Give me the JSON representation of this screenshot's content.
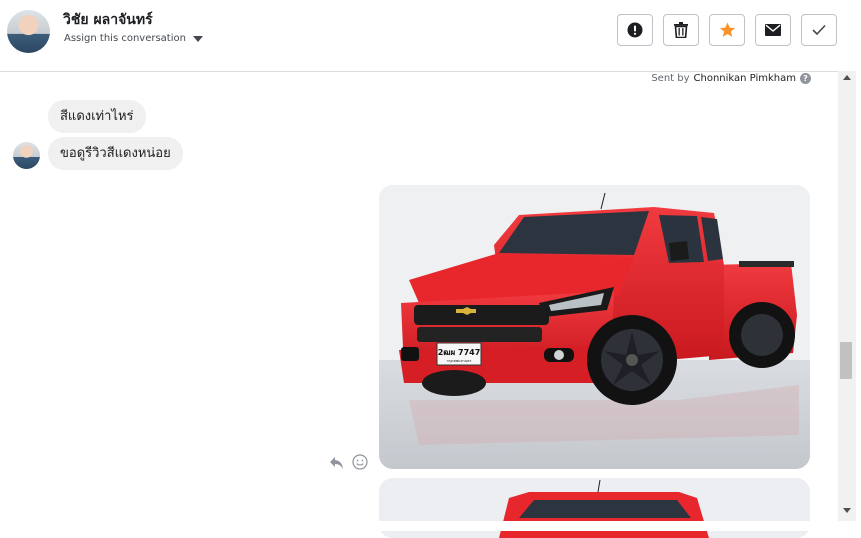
{
  "header": {
    "contact_name": "วิชัย ผลาจันทร์",
    "assign_label": "Assign this conversation",
    "actions": [
      {
        "name": "spam-button",
        "icon": "alert-icon"
      },
      {
        "name": "delete-button",
        "icon": "trash-icon"
      },
      {
        "name": "star-button",
        "icon": "star-icon"
      },
      {
        "name": "mark-unread-button",
        "icon": "envelope-icon"
      },
      {
        "name": "done-button",
        "icon": "check-icon"
      }
    ],
    "star_color": "#f6932b"
  },
  "thread": {
    "sent_by_prefix": "Sent by",
    "sent_by_name": "Chonnikan Pimkham",
    "help_glyph": "?",
    "messages": [
      {
        "text": "สีแดงเท่าไหร่"
      },
      {
        "text": "ขอดูรีวิวสีแดงหน่อย"
      }
    ],
    "attachments": [
      {
        "description": "photo-red-pickup",
        "plate": "2ฒผ 7747",
        "plate_region": "กรุงเทพมหานคร"
      },
      {
        "description": "photo-red-pickup-front"
      }
    ],
    "message_tools": [
      {
        "icon": "reply-icon"
      },
      {
        "icon": "emoji-icon"
      }
    ]
  }
}
